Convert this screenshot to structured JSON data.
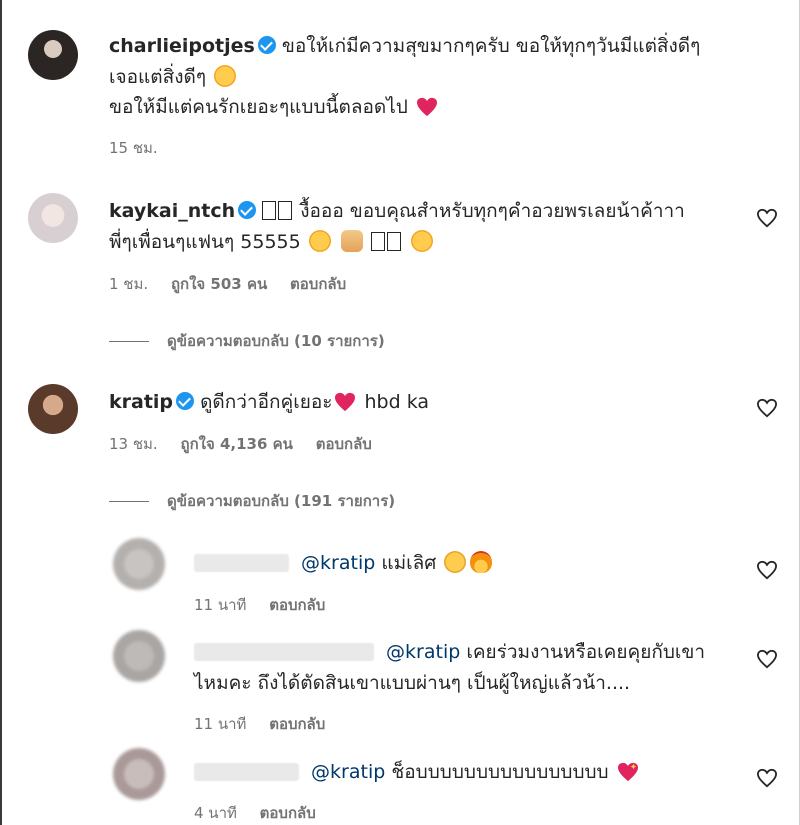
{
  "comments": [
    {
      "username": "charlieipotjes",
      "lines": [
        "ขอให้เก่มีความสุขมากๆครับ ขอให้ทุกๆวันมีแต่สิ่งดีๆ",
        "เจอแต่สิ่งดีๆ",
        "ขอให้มีแต่คนรักเยอะๆแบบนี้ตลอดไป"
      ],
      "time": "15 ชม."
    },
    {
      "username": "kaykai_ntch",
      "lines": [
        "งื้อออ ขอบคุณสำหรับทุกๆคำอวยพรเลยน้าค้าาา",
        "พี่ๆเพื่อนๆแฟนๆ 55555"
      ],
      "time": "1 ชม.",
      "likes": "ถูกใจ 503 คน",
      "reply": "ตอบกลับ",
      "view_replies": "ดูข้อความตอบกลับ (10 รายการ)"
    },
    {
      "username": "kratip",
      "lines": [
        "ดูดีกว่าอีกคู่เยอะ",
        "hbd ka"
      ],
      "time": "13 ชม.",
      "likes": "ถูกใจ 4,136 คน",
      "reply": "ตอบกลับ",
      "view_replies": "ดูข้อความตอบกลับ (191 รายการ)"
    }
  ],
  "replies": [
    {
      "mention": "@kratip",
      "text": "แม่เลิศ",
      "time": "11 นาที",
      "reply": "ตอบกลับ"
    },
    {
      "mention": "@kratip",
      "lines": [
        "เคยร่วมงานหรือเคยคุยกับเขา",
        "ไหมคะ ถึงได้ตัดสินเขาแบบผ่านๆ เป็นผู้ใหญ่แล้วน้า...."
      ],
      "time": "11 นาที",
      "reply": "ตอบกลับ"
    },
    {
      "mention": "@kratip",
      "text": "ช็อบบบบบบบบบบบบบบบบ",
      "time": "4 นาที",
      "reply": "ตอบกลับ"
    }
  ],
  "colors": {
    "verified": "#1c96f0",
    "mention": "#00376b",
    "meta": "#737373"
  },
  "icons": [
    "verified-badge",
    "heart-outline-icon"
  ]
}
